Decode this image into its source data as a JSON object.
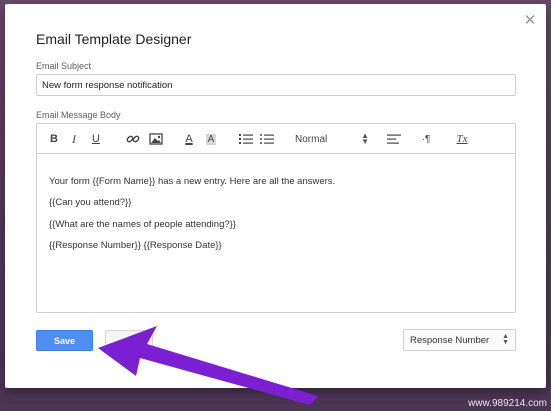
{
  "dialog": {
    "title": "Email Template Designer",
    "close_icon": "close-icon"
  },
  "subject": {
    "label": "Email Subject",
    "value": "New form response notification"
  },
  "body": {
    "label": "Email Message Body",
    "toolbar": {
      "bold": "B",
      "italic": "I",
      "underline": "U",
      "font_color": "A",
      "background_color": "A",
      "size": "Normal",
      "direction": "·¶",
      "clean": "Tx",
      "icons": [
        "link-icon",
        "image-icon",
        "ordered-list-icon",
        "bullet-list-icon",
        "align-icon"
      ]
    },
    "content": [
      "Your form {{Form Name}} has a new entry. Here are all the answers.",
      "{{Can you attend?}}",
      "{{What are the names of people attending?}}",
      "{{Response Number}} {{Response Date}}"
    ]
  },
  "footer": {
    "save_label": "Save",
    "select_value": "Response Number"
  },
  "watermark": "www.989214.com",
  "colors": {
    "background": "#5a3d60",
    "save_button": "#4d8ef0",
    "arrow": "#7a1fd1"
  }
}
